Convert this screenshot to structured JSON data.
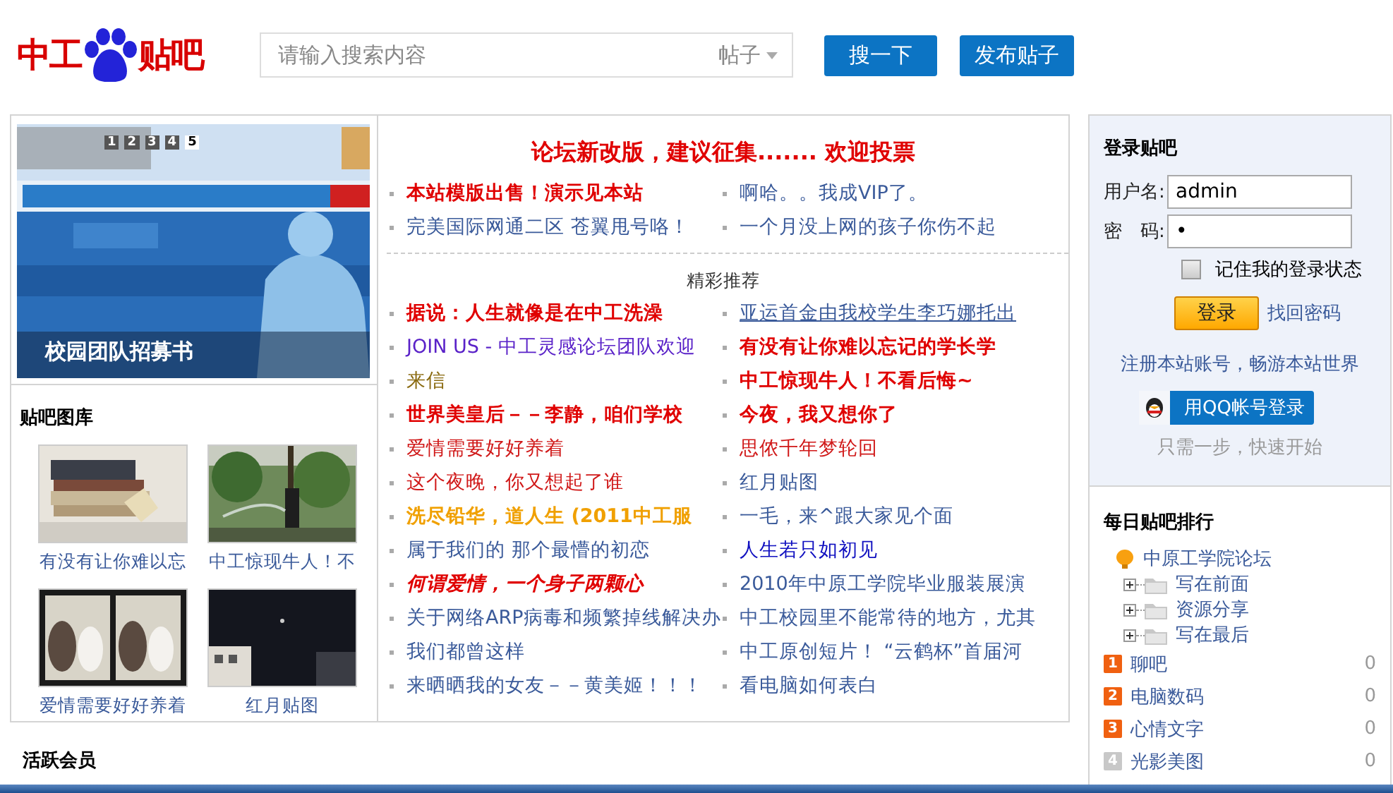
{
  "header": {
    "logo_left": "中工",
    "logo_right": "贴吧",
    "search": {
      "placeholder": "请输入搜索内容",
      "scope": "帖子"
    },
    "buttons": [
      "搜一下",
      "发布贴子"
    ]
  },
  "banner": {
    "kind": "picture",
    "caption": "校园团队招募书",
    "slides": [
      {
        "label": "1",
        "selected": false
      },
      {
        "label": "2",
        "selected": false
      },
      {
        "label": "3",
        "selected": false
      },
      {
        "label": "4",
        "selected": false
      },
      {
        "label": "5",
        "selected": true
      }
    ]
  },
  "gallery": {
    "title": "贴吧图库",
    "items": [
      {
        "kind": "picture",
        "caption": "有没有让你难以忘"
      },
      {
        "kind": "picture",
        "caption": "中工惊现牛人！不"
      },
      {
        "kind": "picture",
        "caption": "爱情需要好好养着"
      },
      {
        "kind": "picture",
        "caption": "红月贴图"
      }
    ]
  },
  "members": {
    "title": "活跃会员"
  },
  "notice": {
    "title": "论坛新改版，建议征集....... 欢迎投票",
    "links": [
      {
        "text": "本站模版出售！演示见本站",
        "color": "#e00000",
        "bold": true,
        "italic": false,
        "underline": false
      },
      {
        "text": "啊哈。。我成VIP了。",
        "color": "#3a5a9a",
        "bold": false,
        "italic": false,
        "underline": false
      },
      {
        "text": "完美国际网通二区 苍翼甩号咯！",
        "color": "#3a5a9a",
        "bold": false,
        "italic": false,
        "underline": false
      },
      {
        "text": "一个月没上网的孩子你伤不起",
        "color": "#3a5a9a",
        "bold": false,
        "italic": false,
        "underline": false
      }
    ]
  },
  "featured": {
    "title": "精彩推荐",
    "links": [
      {
        "text": "据说：人生就像是在中工洗澡",
        "color": "#e00000",
        "bold": true,
        "italic": false,
        "underline": false
      },
      {
        "text": "亚运首金由我校学生李巧娜托出",
        "color": "#3a5a9a",
        "bold": false,
        "italic": false,
        "underline": true
      },
      {
        "text": "JOIN US - 中工灵感论坛团队欢迎",
        "color": "#5a22c8",
        "bold": false,
        "italic": false,
        "underline": false
      },
      {
        "text": "有没有让你难以忘记的学长学",
        "color": "#e00000",
        "bold": true,
        "italic": false,
        "underline": false
      },
      {
        "text": "来信",
        "color": "#8a6a10",
        "bold": false,
        "italic": false,
        "underline": false
      },
      {
        "text": "中工惊现牛人！不看后悔~",
        "color": "#e00000",
        "bold": true,
        "italic": false,
        "underline": false
      },
      {
        "text": "世界美皇后－－李静，咱们学校",
        "color": "#e00000",
        "bold": true,
        "italic": false,
        "underline": false
      },
      {
        "text": "今夜，我又想你了",
        "color": "#e00000",
        "bold": true,
        "italic": false,
        "underline": false
      },
      {
        "text": "爱情需要好好养着",
        "color": "#d01818",
        "bold": false,
        "italic": false,
        "underline": false
      },
      {
        "text": "思侬千年梦轮回",
        "color": "#d01818",
        "bold": false,
        "italic": false,
        "underline": false
      },
      {
        "text": "这个夜晚，你又想起了谁",
        "color": "#d01818",
        "bold": false,
        "italic": false,
        "underline": false
      },
      {
        "text": "红月贴图",
        "color": "#3a5a9a",
        "bold": false,
        "italic": false,
        "underline": false
      },
      {
        "text": "洗尽铅华，道人生 (2011中工服",
        "color": "#f0a000",
        "bold": true,
        "italic": false,
        "underline": false
      },
      {
        "text": "一毛，来^跟大家见个面",
        "color": "#3a5a9a",
        "bold": false,
        "italic": false,
        "underline": false
      },
      {
        "text": "属于我们的  那个最懵的初恋",
        "color": "#3a5a9a",
        "bold": false,
        "italic": false,
        "underline": false
      },
      {
        "text": "人生若只如初见",
        "color": "#1010c0",
        "bold": false,
        "italic": false,
        "underline": false
      },
      {
        "text": "何谓爱情，一个身子两颗心",
        "color": "#e00000",
        "bold": true,
        "italic": true,
        "underline": false
      },
      {
        "text": "2010年中原工学院毕业服装展演",
        "color": "#3a5a9a",
        "bold": false,
        "italic": false,
        "underline": false
      },
      {
        "text": "关于网络ARP病毒和频繁掉线解决办",
        "color": "#3a5a9a",
        "bold": false,
        "italic": false,
        "underline": false
      },
      {
        "text": "中工校园里不能常待的地方，尤其",
        "color": "#3a5a9a",
        "bold": false,
        "italic": false,
        "underline": false
      },
      {
        "text": "我们都曾这样",
        "color": "#3a5a9a",
        "bold": false,
        "italic": false,
        "underline": false
      },
      {
        "text": "中工原创短片！ “云鹤杯”首届河",
        "color": "#3a5a9a",
        "bold": false,
        "italic": false,
        "underline": false
      },
      {
        "text": "来晒晒我的女友－－黄美姬！！！",
        "color": "#3a5a9a",
        "bold": false,
        "italic": false,
        "underline": false
      },
      {
        "text": "看电脑如何表白",
        "color": "#3a5a9a",
        "bold": false,
        "italic": false,
        "underline": false
      }
    ]
  },
  "login": {
    "title": "登录贴吧",
    "username_label": "用户名:",
    "username": "admin",
    "password_label": "密　码:",
    "password": "•",
    "remember": {
      "label": "记住我的登录状态",
      "checked": false
    },
    "submit": "登录",
    "forgot": "找回密码",
    "register": "注册本站账号，畅游本站世界",
    "qq_button": "用QQ帐号登录",
    "hint": "只需一步，快速开始"
  },
  "ranking": {
    "title": "每日贴吧排行",
    "forum": {
      "name": "中原工学院论坛",
      "children": [
        {
          "name": "写在前面",
          "expanded": false
        },
        {
          "name": "资源分享",
          "expanded": false
        },
        {
          "name": "写在最后",
          "expanded": false
        }
      ]
    },
    "boards": [
      {
        "rank": "1",
        "name": "聊吧",
        "count": "0",
        "color": "#f06010"
      },
      {
        "rank": "2",
        "name": "电脑数码",
        "count": "0",
        "color": "#f06010"
      },
      {
        "rank": "3",
        "name": "心情文字",
        "count": "0",
        "color": "#f06010"
      },
      {
        "rank": "4",
        "name": "光影美图",
        "count": "0",
        "color": "#c8c8c8"
      }
    ]
  }
}
